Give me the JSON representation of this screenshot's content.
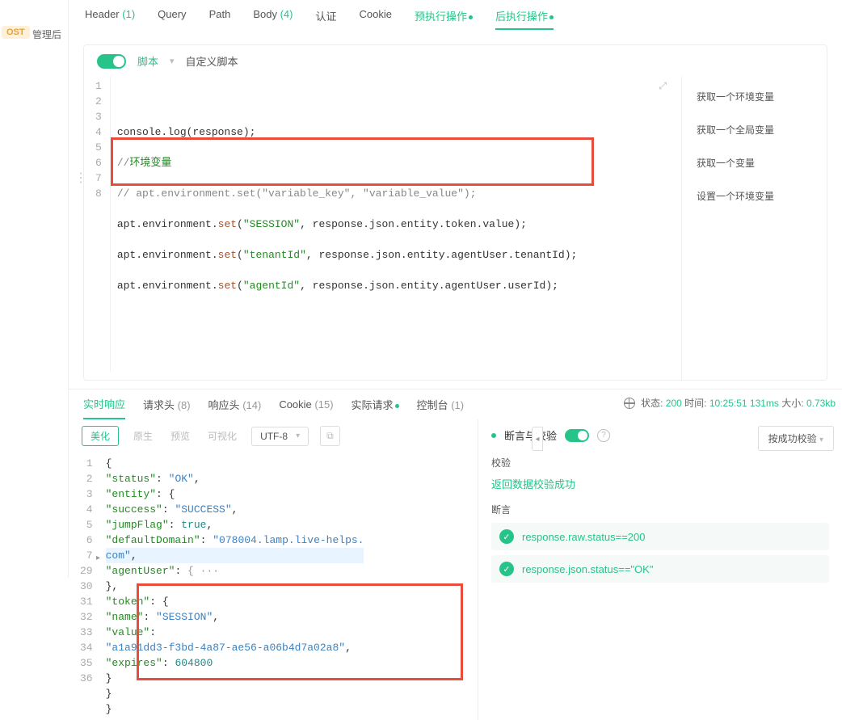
{
  "leftSliver": {
    "badge": "OST",
    "text": "管理后"
  },
  "tabs": [
    {
      "label": "Header",
      "count": "(1)"
    },
    {
      "label": "Query"
    },
    {
      "label": "Path"
    },
    {
      "label": "Body",
      "count": "(4)"
    },
    {
      "label": "认证"
    },
    {
      "label": "Cookie"
    },
    {
      "label": "预执行操作",
      "dot": true
    },
    {
      "label": "后执行操作",
      "dot": true,
      "active": true
    }
  ],
  "scriptHead": {
    "scriptLabel": "脚本",
    "nameLabel": "自定义脚本"
  },
  "code": {
    "nums": [
      "1",
      "2",
      "3",
      "4",
      "5",
      "6",
      "7",
      "8"
    ],
    "l2": "console.log(response);",
    "l3_a": "//",
    "l3_b": "环境变量",
    "l4": "// apt.environment.set(\"variable_key\", \"variable_value\");",
    "l5_a": "apt.environment.",
    "l5_set": "set",
    "l5_p1": "(",
    "l5_s": "\"SESSION\"",
    "l5_p2": ", response.json.entity.token.value);",
    "l6_a": "apt.environment.",
    "l6_set": "set",
    "l6_p1": "(",
    "l6_s": "\"tenantId\"",
    "l6_p2": ", response.json.entity.agentUser.tenantId);",
    "l7_a": "apt.environment.",
    "l7_set": "set",
    "l7_p1": "(",
    "l7_s": "\"agentId\"",
    "l7_p2": ", response.json.entity.agentUser.userId);"
  },
  "sideList": [
    "获取一个环境变量",
    "获取一个全局变量",
    "获取一个变量",
    "设置一个环境变量"
  ],
  "respTabs": [
    {
      "label": "实时响应",
      "active": true
    },
    {
      "label": "请求头",
      "count": "(8)"
    },
    {
      "label": "响应头",
      "count": "(14)"
    },
    {
      "label": "Cookie",
      "count": "(15)"
    },
    {
      "label": "实际请求",
      "dot": true
    },
    {
      "label": "控制台",
      "count": "(1)"
    }
  ],
  "meta": {
    "statusLabel": "状态:",
    "status": "200",
    "timeLabel": "时间:",
    "time": "10:25:51",
    "dur": "131ms",
    "sizeLabel": "大小:",
    "size": "0.73kb"
  },
  "viewTabs": [
    "美化",
    "原生",
    "预览",
    "可视化"
  ],
  "encoding": "UTF-8",
  "json": {
    "nums": [
      "1",
      "2",
      "3",
      "4",
      "5",
      "6",
      "7",
      "29",
      "30",
      "31",
      "32",
      "33",
      "34",
      "35",
      "36"
    ],
    "r1": "{",
    "r2_k": "\"status\"",
    "r2_v": "\"OK\"",
    "r3_k": "\"entity\"",
    "r4_k": "\"success\"",
    "r4_v": "\"SUCCESS\"",
    "r5_k": "\"jumpFlag\"",
    "r5_v": "true",
    "r6_k": "\"defaultDomain\"",
    "r6_v": "\"078004.lamp.live-helps.",
    "r6b": "com\"",
    "r7_k": "\"agentUser\"",
    "r7_v": "{ ···",
    "r29": "},",
    "r30_k": "\"token\"",
    "r31_k": "\"name\"",
    "r31_v": "\"SESSION\"",
    "r32_k": "\"value\"",
    "r32b": "\"a1a91dd3-f3bd-4a87-ae56-a06b4d7a02a8\"",
    "r33_k": "\"expires\"",
    "r33_v": "604800",
    "r34": "}",
    "r35": "}",
    "r36": "}"
  },
  "right": {
    "title": "断言与校验",
    "selLabel": "按成功校验",
    "sect1": "校验",
    "success": "返回数据校验成功",
    "sect2": "断言",
    "a1": "response.raw.status==200",
    "a2": "response.json.status==\"OK\""
  }
}
